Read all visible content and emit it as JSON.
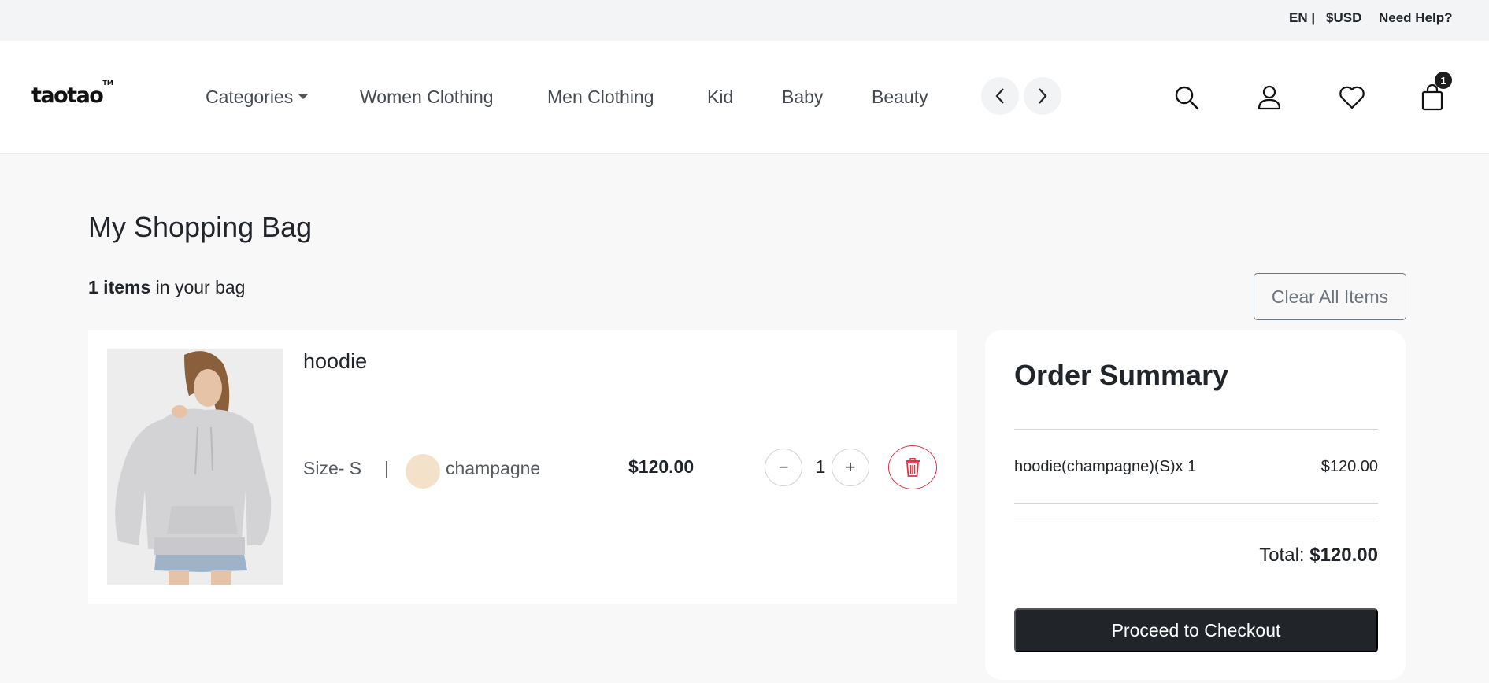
{
  "topbar": {
    "language": "EN |",
    "currency": "$USD",
    "help": "Need Help?"
  },
  "header": {
    "logo_text": "taotao",
    "logo_tm": "TM",
    "nav": [
      "Categories",
      "Women Clothing",
      "Men Clothing",
      "Kid",
      "Baby",
      "Beauty"
    ],
    "cart_count": "1",
    "icons": [
      "chevron-left-icon",
      "chevron-right-icon",
      "search-icon",
      "user-icon",
      "heart-icon",
      "shopping-bag-icon"
    ]
  },
  "page": {
    "title": "My Shopping Bag",
    "items_count_bold": "1 items",
    "items_count_rest": " in your bag",
    "clear_label": "Clear All Items"
  },
  "cart": {
    "items": [
      {
        "name": "hoodie",
        "size_text": "Size- S",
        "separator": "|",
        "color": "champagne",
        "swatch_color": "#f3e2c9",
        "price": "$120.00",
        "quantity": "1",
        "minus_label": "−",
        "plus_label": "+"
      }
    ]
  },
  "summary": {
    "title": "Order Summary",
    "lines": [
      {
        "label": "hoodie(champagne)(S)x 1",
        "price": "$120.00"
      }
    ],
    "total_label": "Total: ",
    "total_value": "$120.00",
    "checkout_label": "Proceed to Checkout"
  },
  "colors": {
    "primary_dark": "#212529",
    "danger": "#dc3545",
    "page_bg": "#f8f8f9"
  }
}
